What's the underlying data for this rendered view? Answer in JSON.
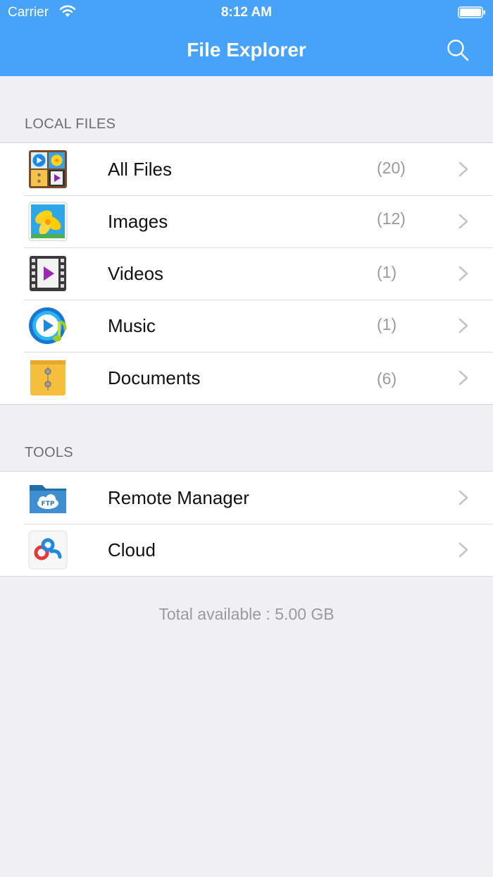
{
  "status_bar": {
    "carrier": "Carrier",
    "time": "8:12 AM"
  },
  "nav": {
    "title": "File Explorer",
    "search_icon": "search-icon"
  },
  "local_files": {
    "header": "LOCAL FILES",
    "items": [
      {
        "label": "All Files",
        "count": "(20)",
        "icon": "all-files-icon"
      },
      {
        "label": "Images",
        "count": "(12)",
        "icon": "images-icon"
      },
      {
        "label": "Videos",
        "count": "(1)",
        "icon": "videos-icon"
      },
      {
        "label": "Music",
        "count": "(1)",
        "icon": "music-icon"
      },
      {
        "label": "Documents",
        "count": "(6)",
        "icon": "documents-icon"
      }
    ]
  },
  "tools": {
    "header": "TOOLS",
    "items": [
      {
        "label": "Remote Manager",
        "icon": "ftp-folder-icon"
      },
      {
        "label": "Cloud",
        "icon": "cloud-icon"
      }
    ]
  },
  "footer": {
    "storage": "Total available : 5.00 GB"
  },
  "colors": {
    "accent": "#47a3fa",
    "background": "#efeff4",
    "secondary_text": "#9a9a9f"
  }
}
